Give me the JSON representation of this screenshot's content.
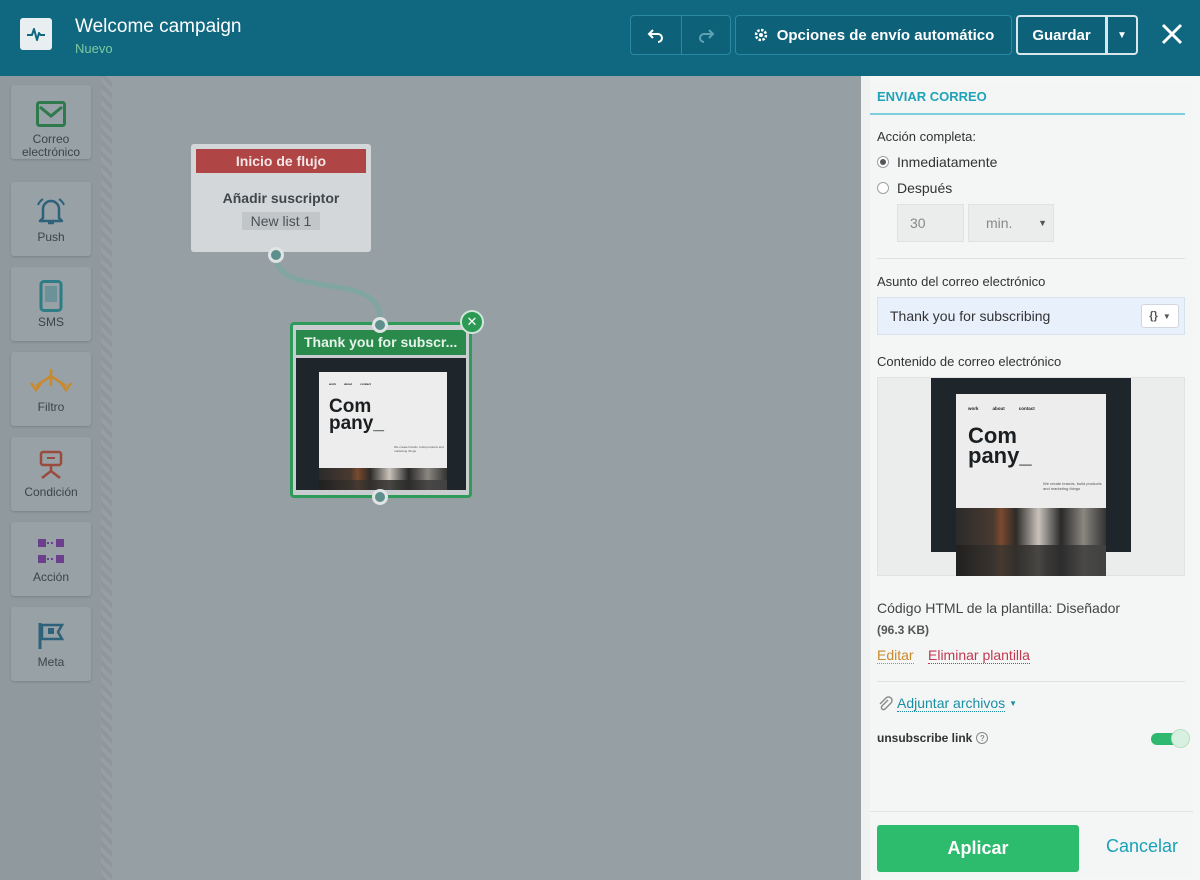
{
  "header": {
    "title": "Welcome campaign",
    "subtitle": "Nuevo",
    "options_label": "Opciones de envío automático",
    "save_label": "Guardar"
  },
  "sidebar": {
    "items": [
      {
        "label": "Correo electrónico",
        "icon": "envelope-icon"
      },
      {
        "label": "Push",
        "icon": "bell-icon"
      },
      {
        "label": "SMS",
        "icon": "mobile-icon"
      },
      {
        "label": "Filtro",
        "icon": "filter-icon"
      },
      {
        "label": "Condición",
        "icon": "condition-icon"
      },
      {
        "label": "Acción",
        "icon": "action-icon"
      },
      {
        "label": "Meta",
        "icon": "flag-icon"
      }
    ]
  },
  "canvas": {
    "start_node": {
      "header": "Inicio de flujo",
      "title": "Añadir suscriptor",
      "tag": "New list 1"
    },
    "email_node": {
      "header": "Thank you for subscr..."
    }
  },
  "template": {
    "nav": [
      "work",
      "about",
      "contact"
    ],
    "brand_line1": "Com",
    "brand_line2": "pany_",
    "tagline": "We create brands, build products and marketing things"
  },
  "panel": {
    "section_title": "ENVIAR CORREO",
    "action_label": "Acción completa:",
    "radio_immediately": "Inmediatamente",
    "radio_after": "Después",
    "delay_value": "30",
    "delay_unit": "min.",
    "subject_label": "Asunto del correo electrónico",
    "subject_value": "Thank you for subscribing",
    "content_label": "Contenido de correo electrónico",
    "template_code": "Código HTML de la plantilla: Diseñador",
    "template_size": "(96.3 KB)",
    "edit_label": "Editar",
    "delete_label": "Eliminar plantilla",
    "attach_label": "Adjuntar archivos",
    "unsubscribe_label": "unsubscribe link",
    "unsubscribe_enabled": true,
    "apply_label": "Aplicar",
    "cancel_label": "Cancelar"
  },
  "colors": {
    "header_bg": "#0f6880",
    "start_node": "#b04545",
    "email_node": "#2a8a4c",
    "accent": "#1ea3b8",
    "apply": "#2dbb6d"
  }
}
